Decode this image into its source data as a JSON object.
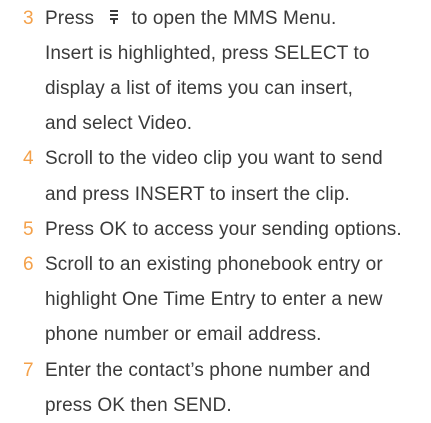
{
  "steps": [
    {
      "number": "3",
      "lines": [
        {
          "before": "Press ",
          "icon": "menu-key-icon",
          "after": "to open the MMS Menu."
        },
        {
          "text": "Insert is highlighted, press SELECT to"
        },
        {
          "text": "display a list of items you can insert,"
        },
        {
          "text": "and select Video."
        }
      ]
    },
    {
      "number": "4",
      "lines": [
        {
          "text": "Scroll to the video clip you want to send"
        },
        {
          "text": "and press INSERT to insert the clip."
        }
      ]
    },
    {
      "number": "5",
      "lines": [
        {
          "text": "Press OK to access your sending options."
        }
      ]
    },
    {
      "number": "6",
      "lines": [
        {
          "text": "Scroll to an existing phonebook entry or"
        },
        {
          "text": "highlight One Time Entry to enter a new"
        },
        {
          "text": "phone number or email address."
        }
      ]
    },
    {
      "number": "7",
      "lines": [
        {
          "text": "Enter the contact’s phone number and"
        },
        {
          "text": "press OK then SEND."
        }
      ]
    }
  ],
  "colors": {
    "step_number": "#f4a14a",
    "body_text": "#3a3a3a"
  }
}
